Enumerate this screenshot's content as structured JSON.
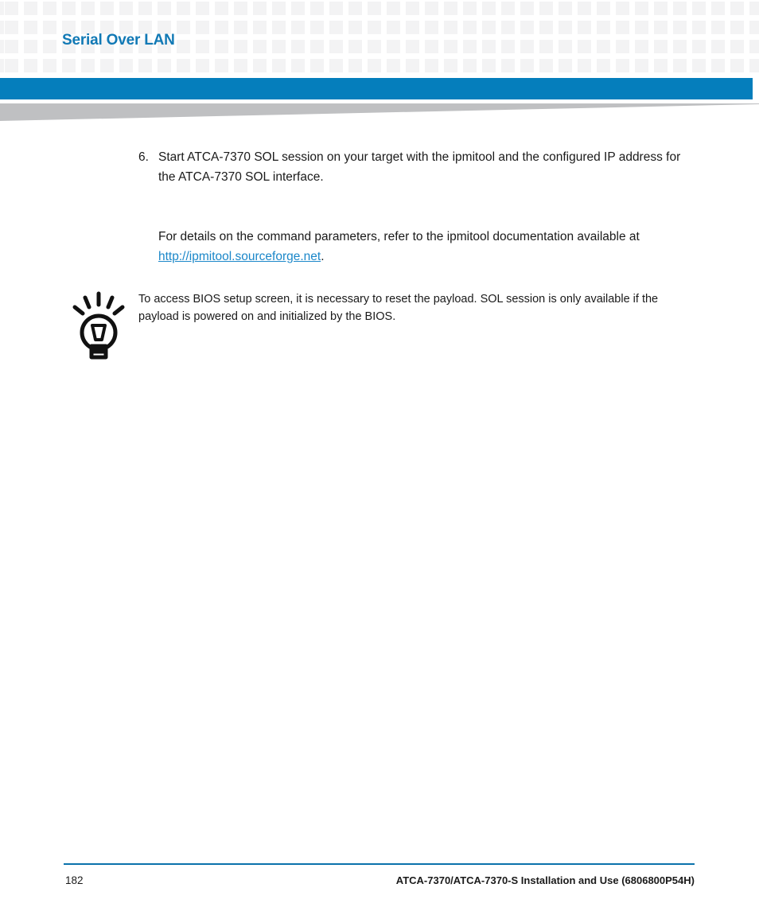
{
  "header": {
    "title": "Serial Over LAN",
    "title_color": "#1179b5",
    "bar_color": "#057ebc",
    "wedge_color": "#bfc0c2",
    "pattern_square_color": "#f3f3f4"
  },
  "content": {
    "step": {
      "number": "6.",
      "text": "Start ATCA-7370 SOL session on your target with the ipmitool and the configured IP address for the ATCA-7370 SOL interface."
    },
    "paragraph": {
      "lead": "For details on the command parameters, refer to the ipmitool documentation available at ",
      "link": "http://ipmitool.sourceforge.net",
      "link_color": "#1b87c9",
      "trail": "."
    },
    "tip": {
      "icon": "lightbulb-icon",
      "text": "To access BIOS setup screen, it is necessary to reset the payload. SOL session is only available if the payload is powered on and initialized by the BIOS."
    }
  },
  "footer": {
    "page_number": "182",
    "document_title": "ATCA-7370/ATCA-7370-S Installation and Use (6806800P54H)",
    "rule_color": "#0a72ab"
  }
}
